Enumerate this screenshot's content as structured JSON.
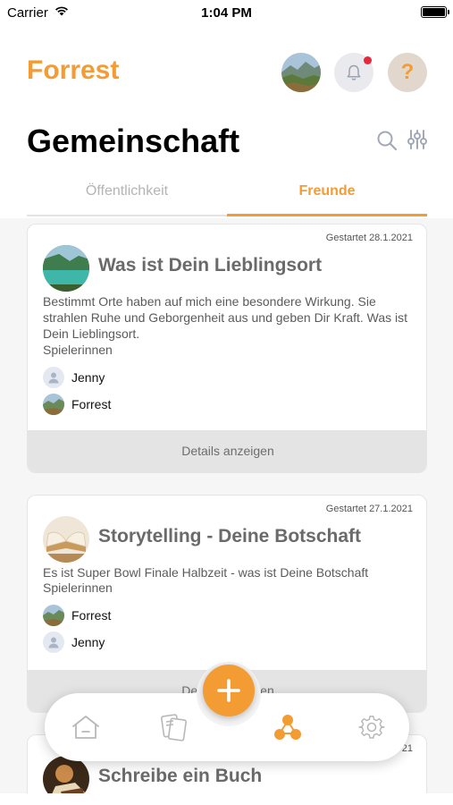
{
  "status_bar": {
    "carrier": "Carrier",
    "time": "1:04 PM"
  },
  "header": {
    "app_title": "Forrest",
    "page_title": "Gemeinschaft"
  },
  "tabs": [
    {
      "label": "Öffentlichkeit",
      "active": false
    },
    {
      "label": "Freunde",
      "active": true
    }
  ],
  "cards": [
    {
      "date": "Gestartet 28.1.2021",
      "title": "Was ist Dein Lieblingsort",
      "description": "Bestimmt Orte haben auf mich eine besondere Wirkung. Sie strahlen Ruhe und Geborgenheit aus und geben Dir Kraft. Was ist Dein Lieblingsort.",
      "players_label": "Spielerinnen",
      "players": [
        {
          "name": "Jenny",
          "avatar": "default-user-icon"
        },
        {
          "name": "Forrest",
          "avatar": "landscape-photo"
        }
      ],
      "details_label": "Details anzeigen"
    },
    {
      "date": "Gestartet 27.1.2021",
      "title": "Storytelling - Deine Botschaft",
      "description": "Es ist Super Bowl Finale Halbzeit - was ist Deine Botschaft",
      "players_label": "Spielerinnen",
      "players": [
        {
          "name": "Forrest",
          "avatar": "landscape-photo"
        },
        {
          "name": "Jenny",
          "avatar": "default-user-icon"
        }
      ],
      "details_label": "Details anzeigen"
    },
    {
      "date": "21",
      "title": "Schreibe ein Buch"
    }
  ],
  "bottom_nav": {
    "items": [
      "home-icon",
      "cards-icon",
      "community-icon",
      "settings-icon"
    ],
    "active": "community-icon",
    "fab_icon": "plus-icon"
  },
  "colors": {
    "accent": "#f39c34",
    "notification": "#e6283c",
    "inactive": "#b4b4b4"
  }
}
